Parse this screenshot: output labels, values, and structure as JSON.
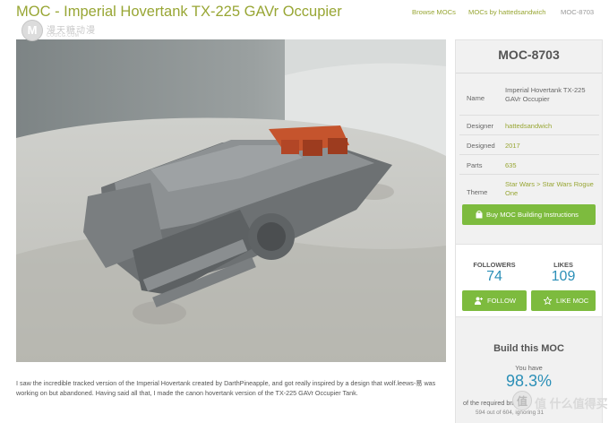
{
  "header": {
    "title": "MOC - Imperial Hovertank TX-225 GAVr Occupier",
    "nav": {
      "browse": "Browse MOCs",
      "by_designer": "MOCs by hattedsandwich",
      "current": "MOC-8703"
    }
  },
  "watermark": {
    "logo_letter": "M",
    "text": "漫天糖动漫",
    "url": "COOCG.COM",
    "bottom_text": "值 什么值得买"
  },
  "photo": {
    "icon": "moc-photo-image"
  },
  "description": "I saw the incredible tracked version of the Imperial Hovertank created by DarthPineapple, and got really inspired by a design that wolf.leews-易 was working on but abandoned. Having said all that, I made the canon hovertank version of the TX-225 GAVr Occupier Tank.",
  "panel": {
    "moc_id": "MOC-8703",
    "specs": {
      "name_label": "Name",
      "name_value": "Imperial Hovertank TX-225 GAVr Occupier",
      "designer_label": "Designer",
      "designer_value": "hattedsandwich",
      "designed_label": "Designed",
      "designed_value": "2017",
      "parts_label": "Parts",
      "parts_value": "635",
      "theme_label": "Theme",
      "theme_value": "Star Wars > Star Wars Rogue One"
    },
    "buy_button": "Buy MOC Building Instructions",
    "stats": {
      "followers_label": "FOLLOWERS",
      "followers_count": "74",
      "likes_label": "LIKES",
      "likes_count": "109",
      "follow_button": "FOLLOW",
      "like_button": "LIKE MOC"
    },
    "build": {
      "title": "Build this MOC",
      "have_label": "You have",
      "have_percent": "98.3%",
      "of_text": "of the required bricks",
      "count_text": "594 out of 604, ignoring 31"
    }
  },
  "colors": {
    "accent_green": "#98a634",
    "button_green": "#7dbb3e",
    "stat_blue": "#2b8fb7",
    "panel_bg": "#f1f1f1"
  }
}
